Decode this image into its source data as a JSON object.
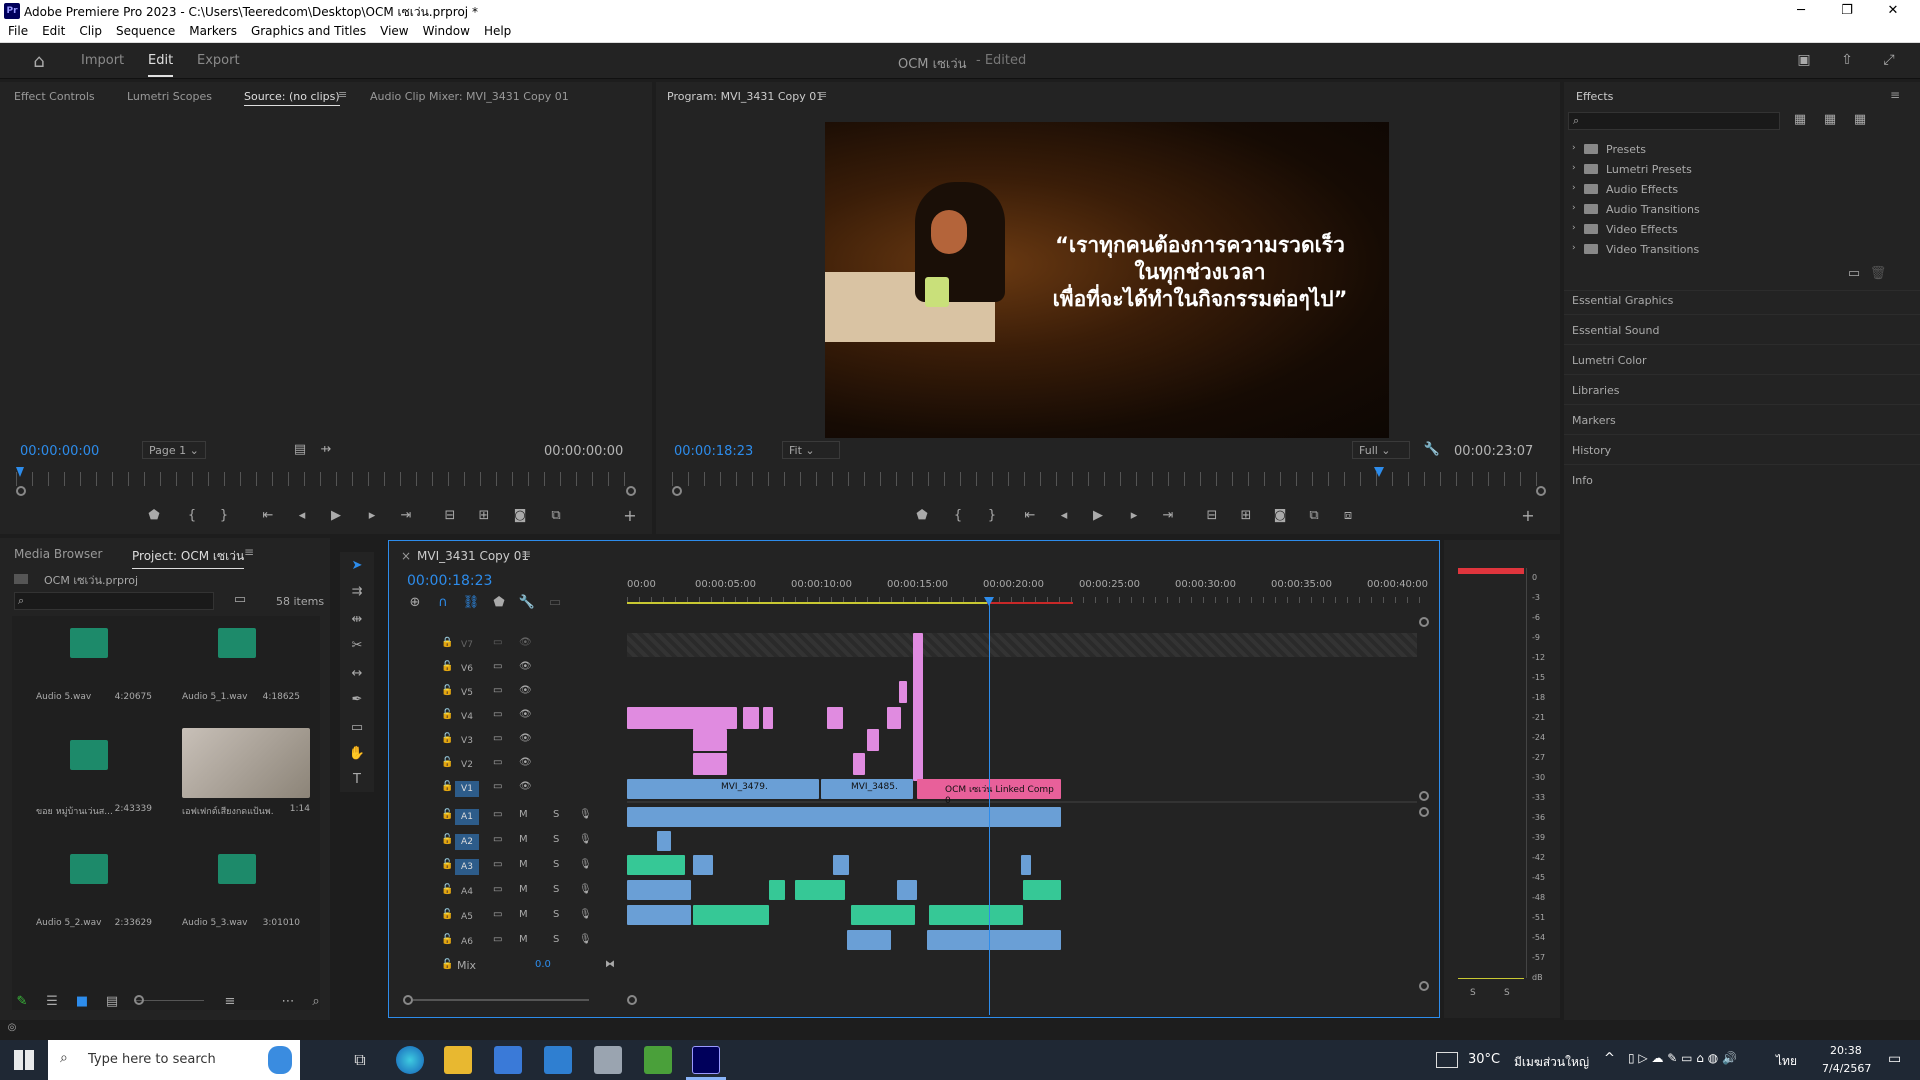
{
  "titlebar": {
    "app_icon": "Pr",
    "title": "Adobe Premiere Pro 2023 - C:\\Users\\Teeredcom\\Desktop\\OCM เซเว่น.prproj *",
    "minimize": "─",
    "maximize": "❐",
    "close": "✕"
  },
  "menu": [
    "File",
    "Edit",
    "Clip",
    "Sequence",
    "Markers",
    "Graphics and Titles",
    "View",
    "Window",
    "Help"
  ],
  "header": {
    "workspaces": [
      "Import",
      "Edit",
      "Export"
    ],
    "active": "Edit",
    "project_title": "OCM เซเว่น",
    "edited": "- Edited"
  },
  "source_panel": {
    "tabs": [
      "Effect Controls",
      "Lumetri Scopes",
      "Source: (no clips)",
      "Audio Clip Mixer: MVI_3431 Copy 01"
    ],
    "active_tab": "Source: (no clips)",
    "timecode": "00:00:00:00",
    "page": "Page 1",
    "end_timecode": "00:00:00:00"
  },
  "program_panel": {
    "title": "Program: MVI_3431 Copy 01",
    "timecode": "00:00:18:23",
    "fit": "Fit",
    "quality": "Full",
    "duration": "00:00:23:07",
    "caption_lines": [
      "“เราทุกคนต้องการความรวดเร็ว",
      "ในทุกช่วงเวลา",
      "เพื่อที่จะได้ทำในกิจกรรมต่อๆไป”"
    ]
  },
  "effects_panel": {
    "title": "Effects",
    "folders": [
      "Presets",
      "Lumetri Presets",
      "Audio Effects",
      "Audio Transitions",
      "Video Effects",
      "Video Transitions"
    ]
  },
  "right_panels": [
    "Essential Graphics",
    "Essential Sound",
    "Lumetri Color",
    "Libraries",
    "Markers",
    "History",
    "Info"
  ],
  "project_panel": {
    "tabs": [
      "Media Browser",
      "Project: OCM เซเว่น"
    ],
    "active_tab": "Project: OCM เซเว่น",
    "project_file": "OCM เซเว่น.prproj",
    "item_count": "58 items",
    "items": [
      {
        "name": "Audio 5.wav",
        "duration": "4:20675",
        "type": "audio"
      },
      {
        "name": "Audio 5_1.wav",
        "duration": "4:18625",
        "type": "audio"
      },
      {
        "name": "ขอย หมู่บ้านเว่นส...",
        "duration": "2:43339",
        "type": "audio"
      },
      {
        "name": "เอฟเฟกต์เสียงกดแป้นพ...",
        "duration": "1:14",
        "type": "video"
      },
      {
        "name": "Audio 5_2.wav",
        "duration": "2:33629",
        "type": "audio"
      },
      {
        "name": "Audio 5_3.wav",
        "duration": "3:01010",
        "type": "audio"
      }
    ]
  },
  "timeline": {
    "sequence": "MVI_3431 Copy 01",
    "timecode": "00:00:18:23",
    "ruler": [
      "00:00",
      "00:00:05:00",
      "00:00:10:00",
      "00:00:15:00",
      "00:00:20:00",
      "00:00:25:00",
      "00:00:30:00",
      "00:00:35:00",
      "00:00:40:00"
    ],
    "video_tracks": [
      "V7",
      "V6",
      "V5",
      "V4",
      "V3",
      "V2",
      "V1"
    ],
    "audio_tracks": [
      "A1",
      "A2",
      "A3",
      "A4",
      "A5",
      "A6"
    ],
    "mix_label": "Mix",
    "mix_value": "0.0",
    "clip_labels": {
      "v1a": "MVI_3479.",
      "v1b": "MVI_3485.",
      "v1c": "OCM เซเว่น Linked Comp 0"
    },
    "track_buttons": {
      "mute": "M",
      "solo": "S"
    }
  },
  "meter": {
    "scale": [
      "0",
      "-3",
      "-6",
      "-9",
      "-12",
      "-15",
      "-18",
      "-21",
      "-24",
      "-27",
      "-30",
      "-33",
      "-36",
      "-39",
      "-42",
      "-45",
      "-48",
      "-51",
      "-54",
      "-57",
      "dB"
    ],
    "solo_labels": [
      "S",
      "S"
    ]
  },
  "taskbar": {
    "search": "Type here to search",
    "weather": "30°C",
    "location": "มีเมฆส่วนใหญ่",
    "lang": "ไทย",
    "time": "20:38",
    "date": "7/4/2567"
  }
}
